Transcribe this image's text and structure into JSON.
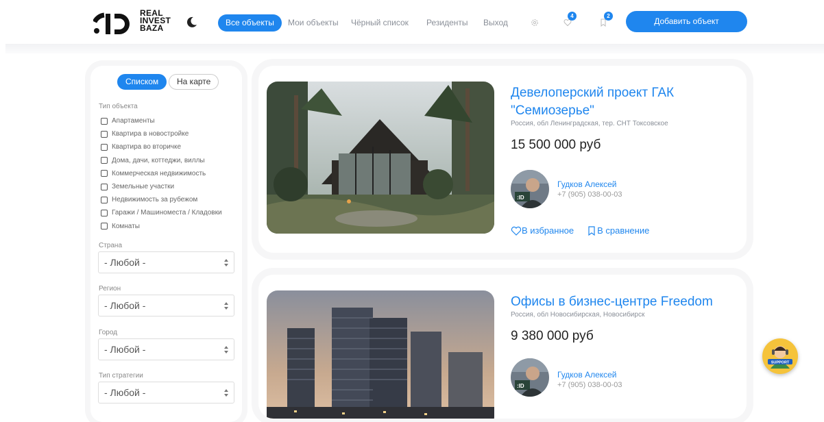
{
  "header": {
    "logo_lines": [
      "REAL",
      "INVEST",
      "BAZA"
    ],
    "nav": [
      {
        "label": "Все объекты",
        "active": true
      },
      {
        "label": "Мои объекты",
        "active": false
      },
      {
        "label": "Чёрный список",
        "active": false
      },
      {
        "label": "Резиденты",
        "active": false
      },
      {
        "label": "Выход",
        "active": false
      }
    ],
    "favorites_count": "4",
    "compare_count": "2",
    "add_button": "Добавить объект"
  },
  "sidebar": {
    "view_list": "Списком",
    "view_map": "На карте",
    "type_title": "Тип объекта",
    "types": [
      "Апартаменты",
      "Квартира в новостройке",
      "Квартира во вторичке",
      "Дома, дачи, коттеджи, виллы",
      "Коммерческая недвижимость",
      "Земельные участки",
      "Недвижимость за рубежом",
      "Гаражи / Машиноместа / Кладовки",
      "Комнаты"
    ],
    "filters": [
      {
        "label": "Страна",
        "value": "- Любой -"
      },
      {
        "label": "Регион",
        "value": "- Любой -"
      },
      {
        "label": "Город",
        "value": "- Любой -"
      },
      {
        "label": "Тип стратегии",
        "value": "- Любой -"
      }
    ]
  },
  "listings": [
    {
      "title": "Девелоперский проект ГАК \"Семиозерье\"",
      "location": "Россия, обл Ленинградская, тер. СНТ Токсовское",
      "price": "15 500 000 руб",
      "agent_name": "Гудков Алексей",
      "agent_phone": "+7 (905) 038-00-03",
      "favorite_label": "В избранное",
      "compare_label": "В сравнение"
    },
    {
      "title": "Офисы в бизнес-центре Freedom",
      "location": "Россия, обл Новосибирская, Новосибирск",
      "price": "9 380 000 руб",
      "agent_name": "Гудков Алексей",
      "agent_phone": "+7 (905) 038-00-03"
    }
  ],
  "colors": {
    "accent": "#1f86ee",
    "support": "#f5c33b"
  }
}
